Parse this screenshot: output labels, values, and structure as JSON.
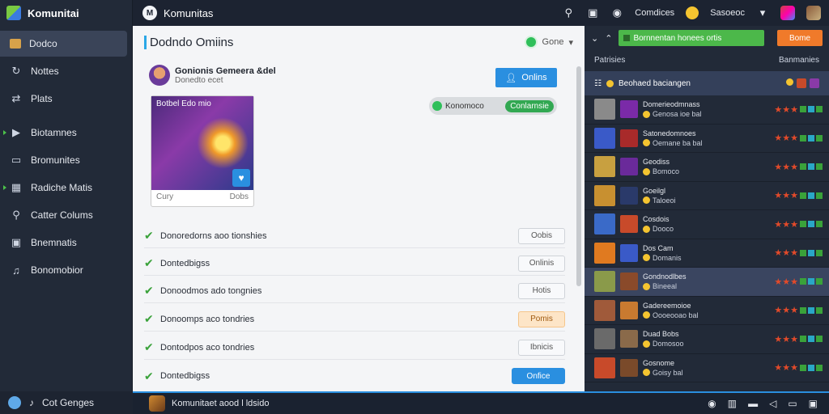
{
  "sidebar": {
    "brand": "Komunitai",
    "items": [
      {
        "label": "Dodco",
        "icon": "folder-icon",
        "active": true
      },
      {
        "label": "Nottes",
        "icon": "loop-icon"
      },
      {
        "label": "Plats",
        "icon": "shuffle-icon"
      },
      {
        "label": "Biotamnes",
        "icon": "play-icon",
        "caret": true
      },
      {
        "label": "Bromunites",
        "icon": "window-icon"
      },
      {
        "label": "Radiche Matis",
        "icon": "grid-icon",
        "caret": true
      },
      {
        "label": "Catter Colums",
        "icon": "key-icon"
      },
      {
        "label": "Bnemnatis",
        "icon": "monitor-icon"
      },
      {
        "label": "Bonomobior",
        "icon": "music-icon"
      }
    ],
    "bottom_label": "Cot Genges"
  },
  "topbar": {
    "app_title": "Komunitas",
    "account_label": "Comdices",
    "coins_label": "Sasoeoc"
  },
  "main": {
    "title": "Dodndo Omiins",
    "done_label": "Gone",
    "user_name": "Gonionis Gemeera &del",
    "user_sub": "Donedto ecet",
    "follow_button": "Onlins",
    "pill_left": "Konomoco",
    "pill_right": "Conlarnsie",
    "game_title": "Botbel Edo mio",
    "game_left": "Cury",
    "game_right": "Dobs",
    "tasks": [
      {
        "label": "Donoredorns aoo tionshies",
        "button": "Oobis",
        "style": ""
      },
      {
        "label": "Dontedbigss",
        "button": "Onlinis",
        "style": ""
      },
      {
        "label": "Donoodmos ado tongnies",
        "button": "Hotis",
        "style": ""
      },
      {
        "label": "Donoomps aco tondries",
        "button": "Pomis",
        "style": "orange"
      },
      {
        "label": "Dontodpos aco tondries",
        "button": "Ibnicis",
        "style": ""
      },
      {
        "label": "Dontedbigss",
        "button": "Onfice",
        "style": "blue"
      }
    ]
  },
  "right": {
    "green_button": "Bornnentan honees ortis",
    "orange_button": "Bome",
    "col_left": "Patrisies",
    "col_right": "Banmanies",
    "section_label": "Beohaed baciangen",
    "rows": [
      {
        "name": "Domerieodmnass",
        "sub": "Genosa ioe bal",
        "c1": "#8a8a8a",
        "c2": "#7a2aa8"
      },
      {
        "name": "Satonedomnoes",
        "sub": "Oemane ba bal",
        "c1": "#3a5ac8",
        "c2": "#a82a2a"
      },
      {
        "name": "Geodiss",
        "sub": "Bomoco",
        "c1": "#c8a040",
        "c2": "#6a2a9a"
      },
      {
        "name": "Goeilgl",
        "sub": "Taloeoi",
        "c1": "#c89030",
        "c2": "#2a3a6a"
      },
      {
        "name": "Cosdois",
        "sub": "Dooco",
        "c1": "#3a6ac8",
        "c2": "#c84a2a"
      },
      {
        "name": "Dos Cam",
        "sub": "Domanis",
        "c1": "#e07a20",
        "c2": "#3a5ac8"
      },
      {
        "name": "Gondnodlbes",
        "sub": "Bineeal",
        "c1": "#8a9a4a",
        "c2": "#8a4a2a"
      },
      {
        "name": "Gadereemoioe",
        "sub": "Oooeooao bal",
        "c1": "#a05a3a",
        "c2": "#c87a30"
      },
      {
        "name": "Duad Bobs",
        "sub": "Domosoo",
        "c1": "#6a6a6a",
        "c2": "#8a6a4a"
      },
      {
        "name": "Gosnome",
        "sub": "Goisy bal",
        "c1": "#c84a2a",
        "c2": "#7a4a2a"
      }
    ]
  },
  "bottombar": {
    "label": "Komunitaet aood l ldsido"
  }
}
